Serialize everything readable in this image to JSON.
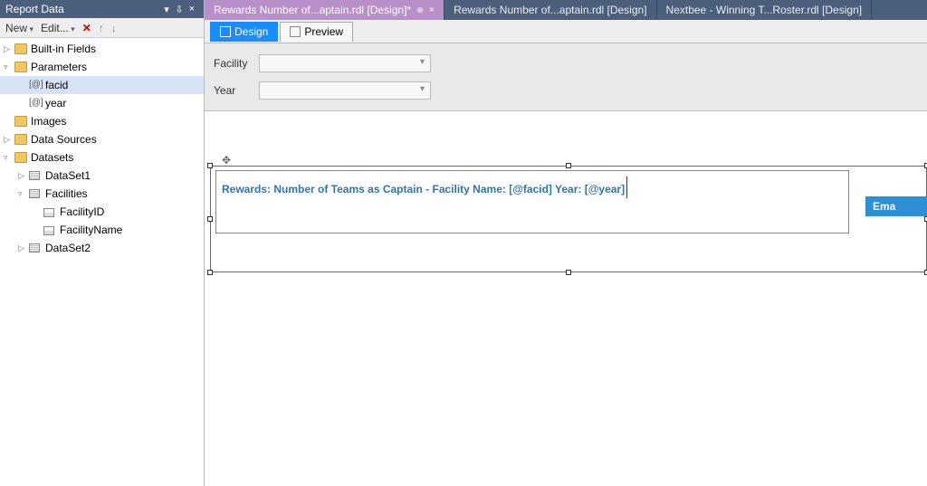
{
  "panel": {
    "title": "Report Data",
    "toolbar": {
      "new": "New",
      "edit": "Edit..."
    }
  },
  "tree": {
    "builtin": "Built-in Fields",
    "parameters": "Parameters",
    "param_facid": "facid",
    "param_year": "year",
    "images": "Images",
    "datasources": "Data Sources",
    "datasets": "Datasets",
    "dataset1": "DataSet1",
    "facilities": "Facilities",
    "facilityid": "FacilityID",
    "facilityname": "FacilityName",
    "dataset2": "DataSet2"
  },
  "tabs": {
    "t1": "Rewards Number of...aptain.rdl [Design]*",
    "t2": "Rewards Number of...aptain.rdl [Design]",
    "t3": "Nextbee - Winning T...Roster.rdl [Design]"
  },
  "modes": {
    "design": "Design",
    "preview": "Preview"
  },
  "paramsBar": {
    "facility": "Facility",
    "year": "Year"
  },
  "report": {
    "title_line": "Rewards: Number of Teams as Captain - Facility Name: [@facid] Year: [@year]",
    "strip": "Ema"
  }
}
